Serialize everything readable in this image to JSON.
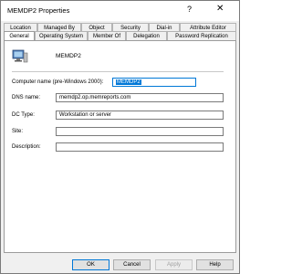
{
  "window": {
    "title": "MEMDP2 Properties",
    "help_glyph": "?",
    "close_glyph": "✕"
  },
  "tabs_row1": [
    "Location",
    "Managed By",
    "Object",
    "Security",
    "Dial-in",
    "Attribute Editor"
  ],
  "tabs_row2": [
    "General",
    "Operating System",
    "Member Of",
    "Delegation",
    "Password Replication"
  ],
  "active_tab": "General",
  "general": {
    "object_name": "MEMDP2",
    "icon": "computer-icon",
    "fields": {
      "pre2000_label": "Computer name (pre-Windows 2000):",
      "pre2000_value": "MEMDP2",
      "dns_label": "DNS name:",
      "dns_value": "memdp2.op.memreports.com",
      "dc_type_label": "DC Type:",
      "dc_type_value": "Workstation or server",
      "site_label": "Site:",
      "site_value": "",
      "description_label": "Description:",
      "description_value": ""
    }
  },
  "buttons": {
    "ok": "OK",
    "cancel": "Cancel",
    "apply": "Apply",
    "help": "Help"
  },
  "colors": {
    "selection": "#0078d7",
    "dialog_bg": "#f0f0f0"
  }
}
